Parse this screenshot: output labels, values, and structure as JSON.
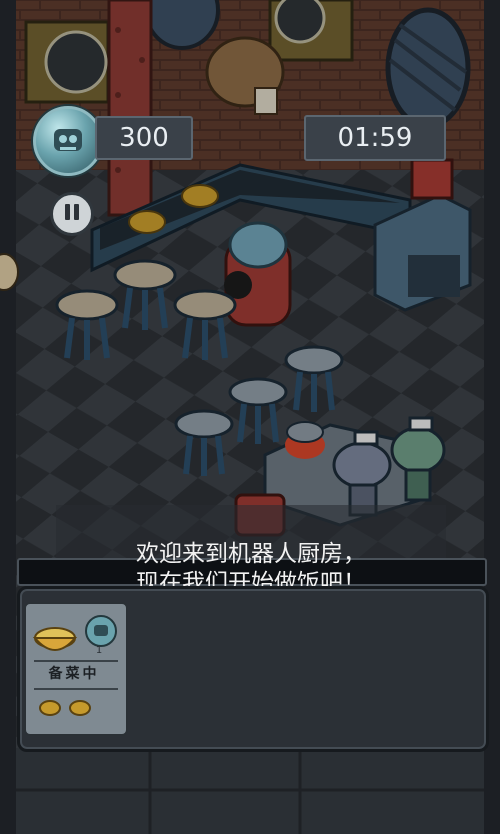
{
  "hud": {
    "score": "300",
    "timer": "01:59",
    "avatar_icon": "robot-head-icon",
    "pause_icon": "pause-icon"
  },
  "dialog": {
    "text": "欢迎来到机器人厨房，\n现在我们开始做饭吧！"
  },
  "order": {
    "dish_icon": "dumpling-bowl-icon",
    "robot_icon": "robot-orb-icon",
    "count": "1",
    "status_label": "备菜中",
    "ingredient_icon": "potato-icon"
  },
  "colors": {
    "panel": "#3a4149",
    "panel_border": "#5b6670",
    "text": "#e9eef2",
    "tray": "#2b3036"
  }
}
